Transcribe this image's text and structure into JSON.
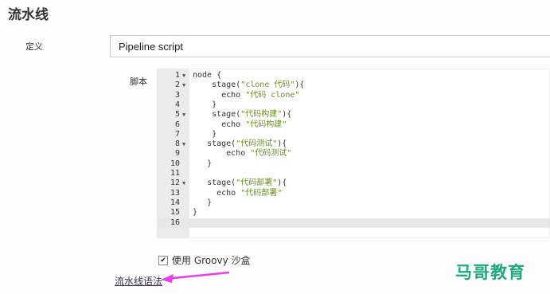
{
  "section": {
    "title": "流水线"
  },
  "definition": {
    "label": "定义",
    "value": "Pipeline script"
  },
  "script": {
    "label": "脚本",
    "lines": [
      {
        "n": "1",
        "fold": true,
        "indent": "",
        "segs": [
          [
            "kw",
            "node {"
          ]
        ]
      },
      {
        "n": "2",
        "fold": true,
        "indent": "    ",
        "segs": [
          [
            "kw",
            "stage("
          ],
          [
            "str",
            "\"clone 代码\""
          ],
          [
            "kw",
            ")"
          ],
          [
            "kw",
            "{"
          ]
        ]
      },
      {
        "n": "3",
        "fold": false,
        "indent": "      ",
        "segs": [
          [
            "kw",
            "echo "
          ],
          [
            "str",
            "\"代码 clone\""
          ]
        ]
      },
      {
        "n": "4",
        "fold": false,
        "indent": "    ",
        "segs": [
          [
            "kw",
            "}"
          ]
        ]
      },
      {
        "n": "5",
        "fold": true,
        "indent": "    ",
        "segs": [
          [
            "kw",
            "stage("
          ],
          [
            "str",
            "\"代码构建\""
          ],
          [
            "kw",
            ")"
          ],
          [
            "kw",
            "{"
          ]
        ]
      },
      {
        "n": "6",
        "fold": false,
        "indent": "      ",
        "segs": [
          [
            "kw",
            "echo "
          ],
          [
            "str",
            "\"代码构建\""
          ]
        ]
      },
      {
        "n": "7",
        "fold": false,
        "indent": "    ",
        "segs": [
          [
            "kw",
            "}"
          ]
        ]
      },
      {
        "n": "8",
        "fold": true,
        "indent": "   ",
        "segs": [
          [
            "kw",
            "stage("
          ],
          [
            "str",
            "\"代码测试\""
          ],
          [
            "kw",
            ")"
          ],
          [
            "kw",
            "{"
          ]
        ]
      },
      {
        "n": "9",
        "fold": false,
        "indent": "       ",
        "segs": [
          [
            "kw",
            "echo "
          ],
          [
            "str",
            "\"代码测试\""
          ]
        ]
      },
      {
        "n": "10",
        "fold": false,
        "indent": "   ",
        "segs": [
          [
            "kw",
            "}"
          ]
        ]
      },
      {
        "n": "11",
        "fold": false,
        "indent": "",
        "segs": []
      },
      {
        "n": "12",
        "fold": true,
        "indent": "   ",
        "segs": [
          [
            "kw",
            "stage("
          ],
          [
            "str",
            "\"代码部署\""
          ],
          [
            "kw",
            ")"
          ],
          [
            "kw",
            "{"
          ]
        ]
      },
      {
        "n": "13",
        "fold": false,
        "indent": "     ",
        "segs": [
          [
            "kw",
            "echo "
          ],
          [
            "str",
            "\"代码部署\""
          ]
        ]
      },
      {
        "n": "14",
        "fold": false,
        "indent": "   ",
        "segs": [
          [
            "kw",
            "}"
          ]
        ]
      },
      {
        "n": "15",
        "fold": false,
        "indent": "",
        "segs": [
          [
            "kw",
            "}"
          ]
        ]
      },
      {
        "n": "16",
        "fold": false,
        "indent": "",
        "segs": [],
        "active": true
      }
    ]
  },
  "groovy_sandbox": {
    "label": "使用 Groovy 沙盒",
    "checked": true
  },
  "syntax_link": {
    "label": "流水线语法"
  },
  "watermark": {
    "text": "马哥教育",
    "color": "#1fa87a"
  },
  "annotation": {
    "arrow_color": "#e83ee8"
  }
}
